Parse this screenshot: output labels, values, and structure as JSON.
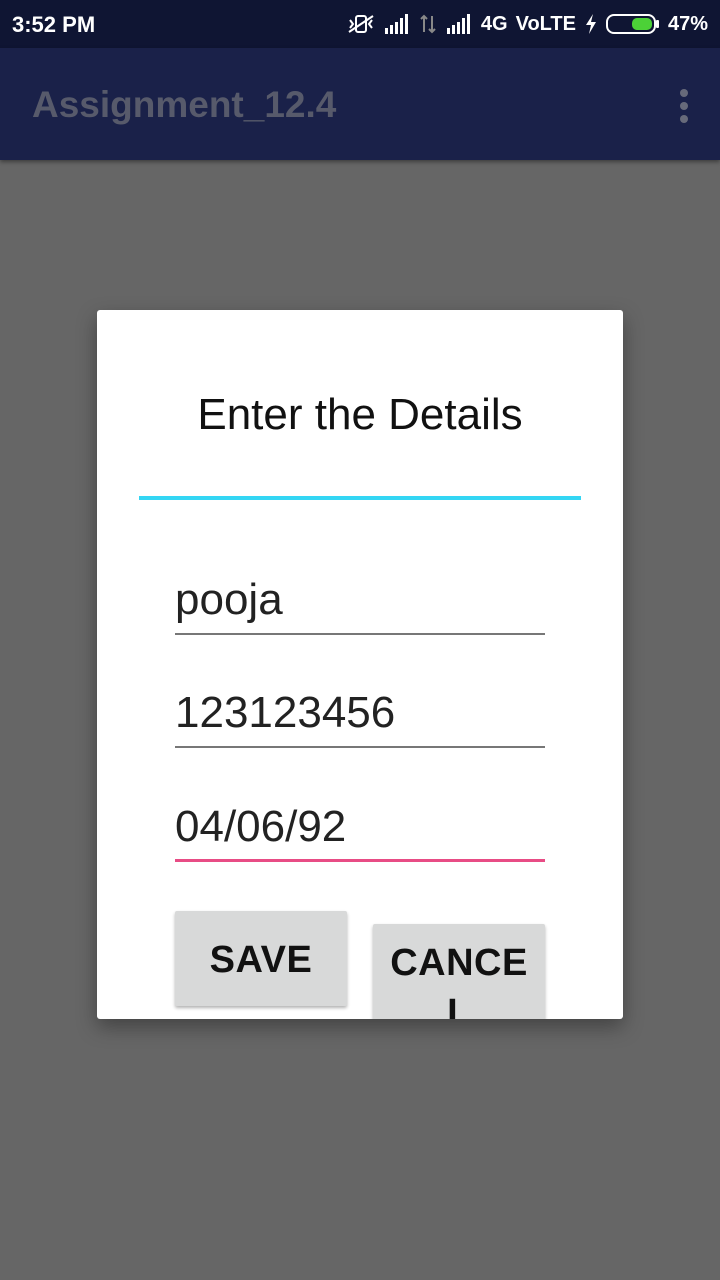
{
  "status_bar": {
    "time": "3:52 PM",
    "network": "4G",
    "volte": "VoLTE",
    "battery_percent": "47%",
    "battery_level": 0.47
  },
  "app_bar": {
    "title": "Assignment_12.4",
    "menu_icon": "more-vert-icon"
  },
  "dialog": {
    "title": "Enter the Details",
    "fields": {
      "name_value": "pooja",
      "phone_value": "123123456",
      "date_value": "04/06/92"
    },
    "buttons": {
      "save_label": "SAVE",
      "cancel_label": "CANCEL"
    }
  },
  "colors": {
    "accent_underline": "#e84c85",
    "title_divider": "#33d6f4",
    "app_bar": "#1a2149",
    "status_bar": "#0f1533",
    "scrim": "#666666"
  }
}
